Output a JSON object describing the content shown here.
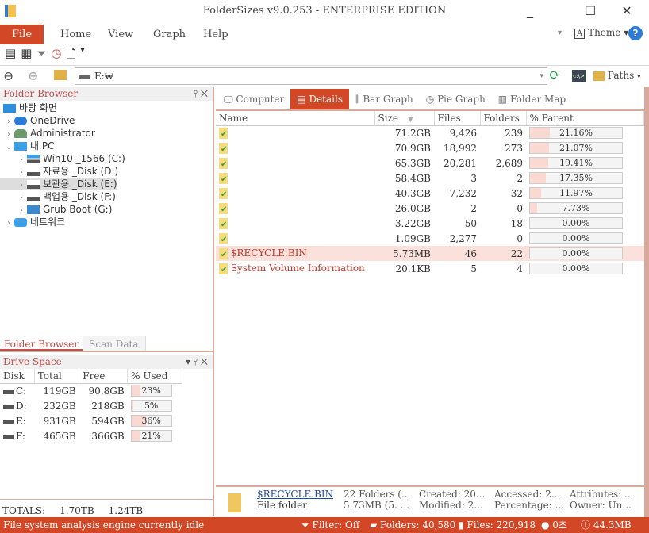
{
  "window": {
    "title": "FolderSizes v9.0.253 - ENTERPRISE EDITION",
    "minimize": "_",
    "maximize": "☐",
    "close": "✕"
  },
  "menu": {
    "file": "File",
    "items": [
      "Home",
      "View",
      "Graph",
      "Help"
    ],
    "theme": "Theme",
    "help_icon": "?"
  },
  "address": {
    "path": "E:₩",
    "paths_label": "Paths"
  },
  "folder_browser": {
    "title": "Folder Browser",
    "tree": [
      {
        "label": "바탕 화면",
        "icon": "desktop-icon",
        "level": 0,
        "chev": ""
      },
      {
        "label": "OneDrive",
        "icon": "cloud-icon",
        "level": 0,
        "chev": ">"
      },
      {
        "label": "Administrator",
        "icon": "user-icon",
        "level": 0,
        "chev": ">"
      },
      {
        "label": "내 PC",
        "icon": "pc-icon",
        "level": 0,
        "chev": "v"
      },
      {
        "label": "Win10 _1566 (C:)",
        "icon": "windows-drive-icon",
        "level": 1,
        "chev": ">"
      },
      {
        "label": "자료용 _Disk (D:)",
        "icon": "drive-icon",
        "level": 1,
        "chev": ">"
      },
      {
        "label": "보관용 _Disk (E:)",
        "icon": "drive-icon",
        "level": 1,
        "chev": ">",
        "selected": true
      },
      {
        "label": "백업용 _Disk (F:)",
        "icon": "drive-icon",
        "level": 1,
        "chev": ">"
      },
      {
        "label": "Grub Boot (G:)",
        "icon": "boot-drive-icon",
        "level": 1,
        "chev": ">"
      },
      {
        "label": "네트워크",
        "icon": "network-icon",
        "level": 0,
        "chev": ">"
      }
    ],
    "tabs": [
      "Folder Browser",
      "Scan Data"
    ]
  },
  "drive_space": {
    "title": "Drive Space",
    "columns": [
      "Disk",
      "Total",
      "Free",
      "% Used"
    ],
    "rows": [
      {
        "disk": "C:",
        "total": "119GB",
        "free": "90.8GB",
        "used": "23%",
        "pct": 23
      },
      {
        "disk": "D:",
        "total": "232GB",
        "free": "218GB",
        "used": "5%",
        "pct": 5
      },
      {
        "disk": "E:",
        "total": "931GB",
        "free": "594GB",
        "used": "36%",
        "pct": 36
      },
      {
        "disk": "F:",
        "total": "465GB",
        "free": "366GB",
        "used": "21%",
        "pct": 21
      }
    ],
    "totals_label": "TOTALS:",
    "totals_total": "1.70TB",
    "totals_free": "1.24TB"
  },
  "view_tabs": [
    "Computer",
    "Details",
    "Bar Graph",
    "Pie Graph",
    "Folder Map"
  ],
  "details": {
    "columns": [
      "Name",
      "Size",
      "Files",
      "Folders",
      "% Parent"
    ],
    "rows": [
      {
        "name": "",
        "size": "71.2GB",
        "files": "9,426",
        "folders": "239",
        "parent": "21.16%",
        "pct": 21.16
      },
      {
        "name": "",
        "size": "70.9GB",
        "files": "18,992",
        "folders": "273",
        "parent": "21.07%",
        "pct": 21.07
      },
      {
        "name": "",
        "size": "65.3GB",
        "files": "20,281",
        "folders": "2,689",
        "parent": "19.41%",
        "pct": 19.41
      },
      {
        "name": "",
        "size": "58.4GB",
        "files": "3",
        "folders": "2",
        "parent": "17.35%",
        "pct": 17.35
      },
      {
        "name": "",
        "size": "40.3GB",
        "files": "7,232",
        "folders": "32",
        "parent": "11.97%",
        "pct": 11.97
      },
      {
        "name": "",
        "size": "26.0GB",
        "files": "2",
        "folders": "0",
        "parent": "7.73%",
        "pct": 7.73
      },
      {
        "name": "",
        "size": "3.22GB",
        "files": "50",
        "folders": "18",
        "parent": "0.00%",
        "pct": 0
      },
      {
        "name": "",
        "size": "1.09GB",
        "files": "2,277",
        "folders": "0",
        "parent": "0.00%",
        "pct": 0
      },
      {
        "name": "$RECYCLE.BIN",
        "size": "5.73MB",
        "files": "46",
        "folders": "22",
        "parent": "0.00%",
        "pct": 0,
        "selected": true
      },
      {
        "name": "System Volume Information",
        "size": "20.1KB",
        "files": "5",
        "folders": "4",
        "parent": "0.00%",
        "pct": 0
      }
    ]
  },
  "info": {
    "name": "$RECYCLE.BIN",
    "type": "File folder",
    "c1a": "22 Folders (...",
    "c1b": "5.73MB (5. ...",
    "c2a": "Created: 20...",
    "c2b": "Modified: 2...",
    "c3a": "Accessed: 2...",
    "c3b": "Percentage: ...",
    "c4a": "Attributes: ...",
    "c4b": "Owner: Un..."
  },
  "status": {
    "message": "File system analysis engine currently idle",
    "filter": "Filter: Off",
    "folders": "Folders: 40,580",
    "files": "Files: 220,918",
    "time": "0초",
    "memory": "44.3MB"
  },
  "colors": {
    "accent": "#d24726",
    "bar_fill": "#f9d9d2"
  }
}
